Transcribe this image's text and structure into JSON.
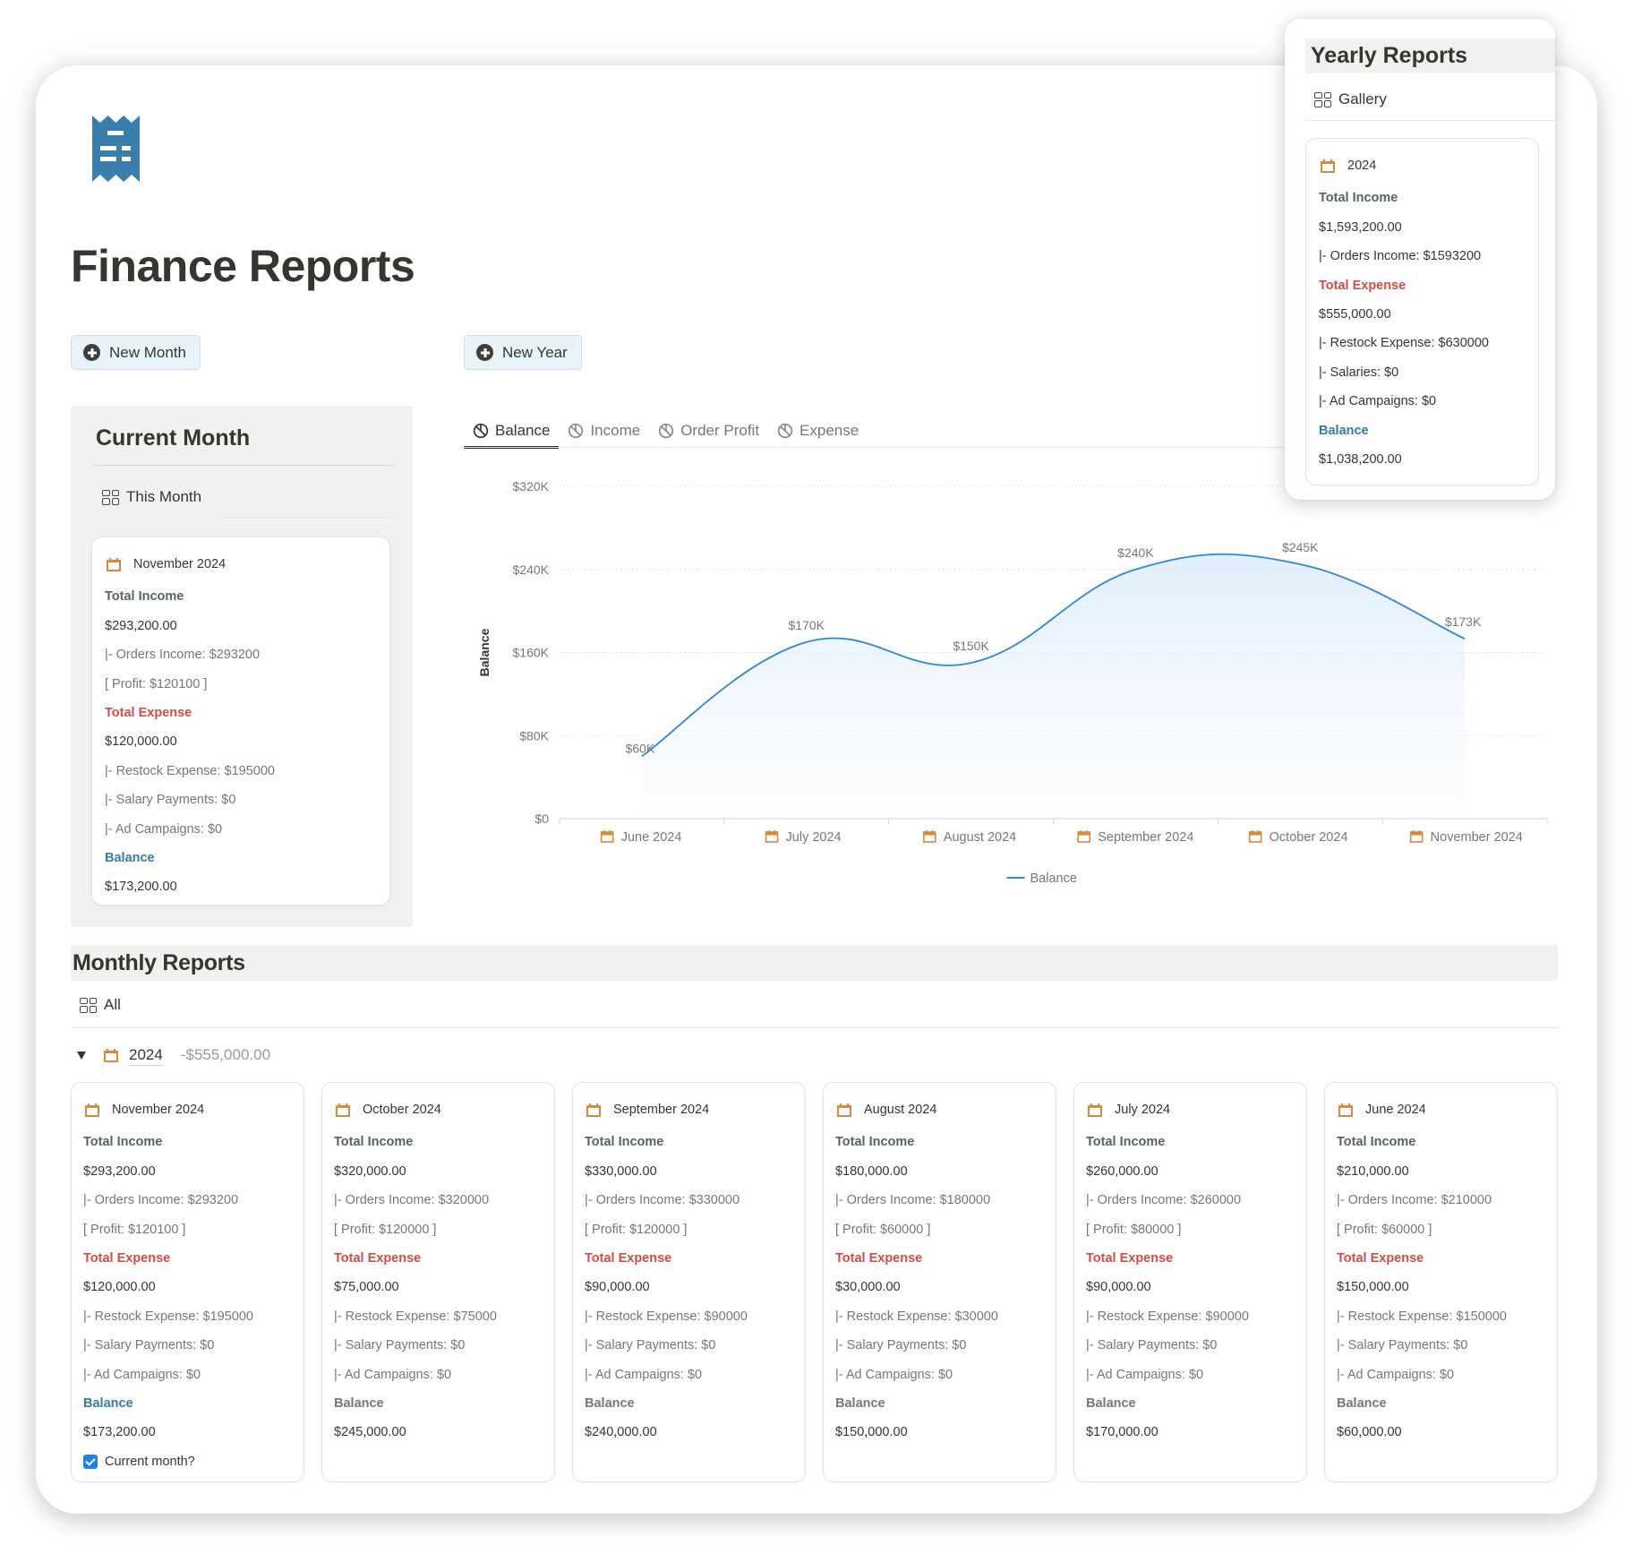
{
  "page": {
    "title": "Finance Reports",
    "icon": "receipt-icon",
    "accent_color": "#3a7fab"
  },
  "buttons": {
    "new_month": "New Month",
    "new_year": "New Year"
  },
  "current_month": {
    "title": "Current Month",
    "view_label": "This Month",
    "card": {
      "name": "November 2024",
      "total_income_label": "Total Income",
      "total_income": "$293,200.00",
      "orders_income": "|- Orders Income: $293200",
      "profit": "[ Profit: $120100 ]",
      "total_expense_label": "Total Expense",
      "total_expense": "$120,000.00",
      "restock": "|- Restock Expense: $195000",
      "salary": "|- Salary Payments: $0",
      "ads": "|- Ad Campaigns: $0",
      "balance_label": "Balance",
      "balance": "$173,200.00"
    }
  },
  "chart_tabs": [
    {
      "label": "Balance",
      "active": true
    },
    {
      "label": "Income",
      "active": false
    },
    {
      "label": "Order Profit",
      "active": false
    },
    {
      "label": "Expense",
      "active": false
    }
  ],
  "chart_data": {
    "type": "area",
    "title": "",
    "xlabel": "",
    "ylabel": "Balance",
    "categories": [
      "June 2024",
      "July 2024",
      "August 2024",
      "September 2024",
      "October 2024",
      "November 2024"
    ],
    "series": [
      {
        "name": "Balance",
        "values": [
          60000,
          170000,
          150000,
          240000,
          245000,
          173200
        ],
        "color": "#2f86dd"
      }
    ],
    "data_labels": [
      "$60K",
      "$170K",
      "$150K",
      "$240K",
      "$245K",
      "$173K"
    ],
    "y_ticks": [
      0,
      80000,
      160000,
      240000,
      320000
    ],
    "y_tick_labels": [
      "$0",
      "$80K",
      "$160K",
      "$240K",
      "$320K"
    ],
    "ylim": [
      0,
      320000
    ],
    "grid": true,
    "legend": {
      "position": "bottom-center",
      "entries": [
        "Balance"
      ]
    }
  },
  "yearly_reports": {
    "title": "Yearly Reports",
    "view_label": "Gallery",
    "card": {
      "name": "2024",
      "total_income_label": "Total Income",
      "total_income": "$1,593,200.00",
      "orders_income": "|- Orders Income: $1593200",
      "total_expense_label": "Total Expense",
      "total_expense": "$555,000.00",
      "restock": "|- Restock Expense: $630000",
      "salaries": "|- Salaries: $0",
      "ads": "|- Ad Campaigns: $0",
      "balance_label": "Balance",
      "balance": "$1,038,200.00"
    }
  },
  "monthly_reports": {
    "title": "Monthly Reports",
    "view_label": "All",
    "group": {
      "name": "2024",
      "sum": "-$555,000.00",
      "expanded": true
    },
    "labels": {
      "total_income": "Total Income",
      "total_expense": "Total Expense",
      "balance": "Balance",
      "current_month": "Current month?"
    },
    "cards": [
      {
        "name": "November 2024",
        "total_income": "$293,200.00",
        "orders_income": "|- Orders Income: $293200",
        "profit": "[ Profit: $120100 ]",
        "total_expense": "$120,000.00",
        "restock": "|- Restock Expense: $195000",
        "salary": "|- Salary Payments: $0",
        "ads": "|- Ad Campaigns: $0",
        "balance": "$173,200.00",
        "current": true
      },
      {
        "name": "October 2024",
        "total_income": "$320,000.00",
        "orders_income": "|- Orders Income: $320000",
        "profit": "[ Profit: $120000 ]",
        "total_expense": "$75,000.00",
        "restock": "|- Restock Expense: $75000",
        "salary": "|- Salary Payments: $0",
        "ads": "|- Ad Campaigns: $0",
        "balance": "$245,000.00",
        "current": false
      },
      {
        "name": "September 2024",
        "total_income": "$330,000.00",
        "orders_income": "|- Orders Income: $330000",
        "profit": "[ Profit: $120000 ]",
        "total_expense": "$90,000.00",
        "restock": "|- Restock Expense: $90000",
        "salary": "|- Salary Payments: $0",
        "ads": "|- Ad Campaigns: $0",
        "balance": "$240,000.00",
        "current": false
      },
      {
        "name": "August 2024",
        "total_income": "$180,000.00",
        "orders_income": "|- Orders Income: $180000",
        "profit": "[ Profit: $60000 ]",
        "total_expense": "$30,000.00",
        "restock": "|- Restock Expense: $30000",
        "salary": "|- Salary Payments: $0",
        "ads": "|- Ad Campaigns: $0",
        "balance": "$150,000.00",
        "current": false
      },
      {
        "name": "July 2024",
        "total_income": "$260,000.00",
        "orders_income": "|- Orders Income: $260000",
        "profit": "[ Profit: $80000 ]",
        "total_expense": "$90,000.00",
        "restock": "|- Restock Expense: $90000",
        "salary": "|- Salary Payments: $0",
        "ads": "|- Ad Campaigns: $0",
        "balance": "$170,000.00",
        "current": false
      },
      {
        "name": "June 2024",
        "total_income": "$210,000.00",
        "orders_income": "|- Orders Income: $210000",
        "profit": "[ Profit: $60000 ]",
        "total_expense": "$150,000.00",
        "restock": "|- Restock Expense: $150000",
        "salary": "|- Salary Payments: $0",
        "ads": "|- Ad Campaigns: $0",
        "balance": "$60,000.00",
        "current": false
      }
    ]
  }
}
